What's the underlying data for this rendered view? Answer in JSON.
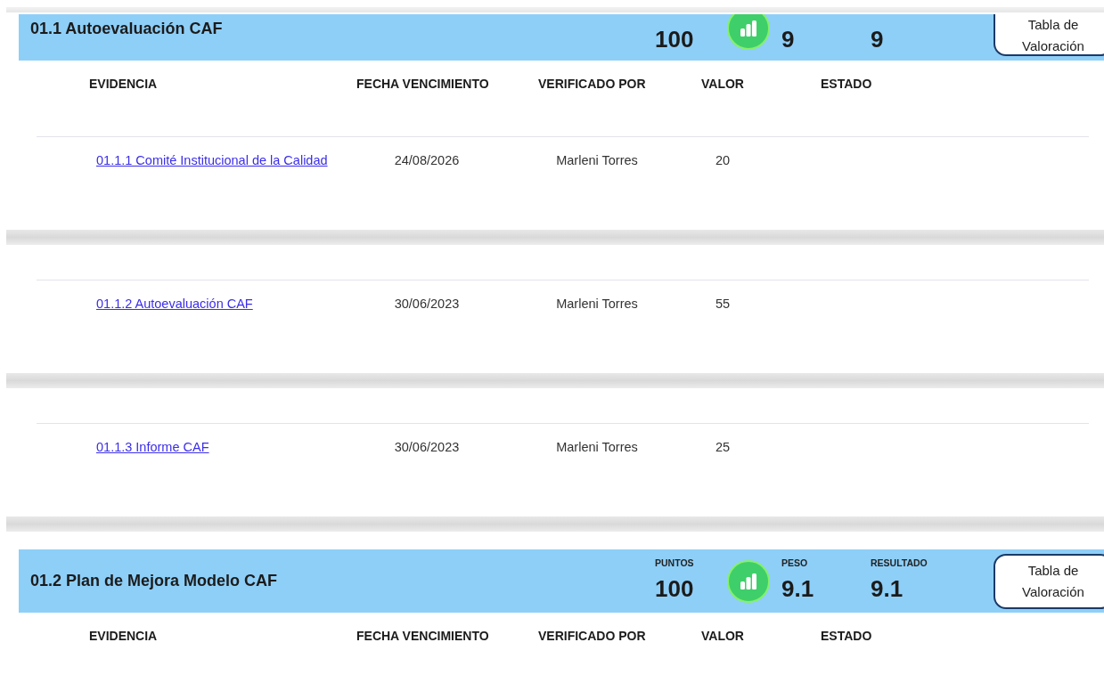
{
  "sections": [
    {
      "title": "01.1 Autoevaluación CAF",
      "metrics": [
        {
          "kind": "points",
          "value": "100"
        },
        {
          "kind": "weight",
          "value": "9"
        },
        {
          "kind": "result",
          "value": "9"
        }
      ],
      "button": "Tabla de Valoración",
      "columns": [
        "EVIDENCIA",
        "FECHA VENCIMIENTO",
        "VERIFICADO POR",
        "VALOR",
        "ESTADO"
      ],
      "rows": [
        {
          "evidence": "01.1.1 Comité Institucional de la Calidad",
          "due": "24/08/2026",
          "verifier": "Marleni Torres",
          "value": "20"
        },
        {
          "evidence": "01.1.2 Autoevaluación CAF",
          "due": "30/06/2023",
          "verifier": "Marleni Torres",
          "value": "55"
        },
        {
          "evidence": "01.1.3 Informe CAF",
          "due": "30/06/2023",
          "verifier": "Marleni Torres",
          "value": "25"
        }
      ]
    },
    {
      "title": "01.2 Plan de Mejora Modelo CAF",
      "metrics": [
        {
          "kind": "points",
          "label": "PUNTOS",
          "value": "100"
        },
        {
          "kind": "weight",
          "label": "PESO",
          "value": "9.1"
        },
        {
          "kind": "result",
          "label": "RESULTADO",
          "value": "9.1"
        }
      ],
      "button": "Tabla de Valoración",
      "columns": [
        "EVIDENCIA",
        "FECHA VENCIMIENTO",
        "VERIFICADO POR",
        "VALOR",
        "ESTADO"
      ]
    }
  ]
}
